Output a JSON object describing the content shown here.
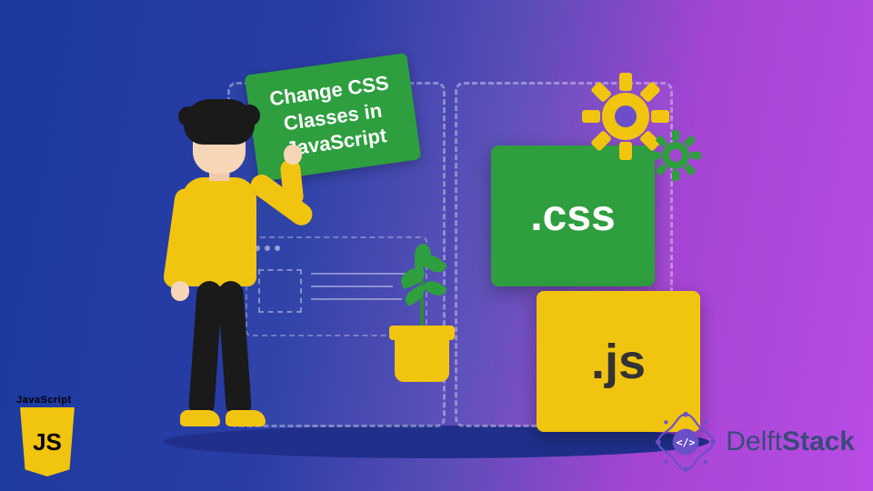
{
  "banner": {
    "title": "Change CSS Classes in JavaScript"
  },
  "cards": {
    "css": ".css",
    "js": ".js"
  },
  "jsLogo": {
    "label": "JavaScript",
    "mono": "JS"
  },
  "brand": {
    "name_prefix": "Delft",
    "name_suffix": "Stack"
  },
  "colors": {
    "green": "#2e9e3f",
    "yellow": "#f1c40f",
    "purple": "#6a4fc9"
  }
}
